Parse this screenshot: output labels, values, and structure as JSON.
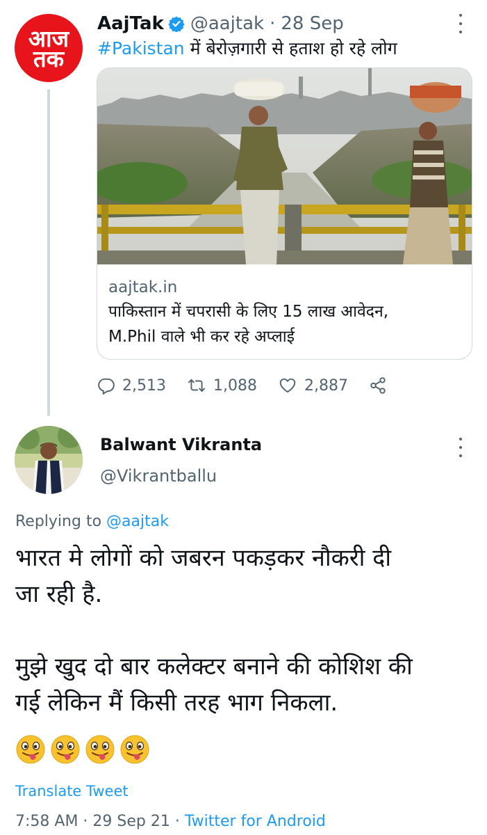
{
  "tweet": {
    "author_name": "AajTak",
    "author_handle": "@aajtak",
    "separator": "·",
    "date": "28 Sep",
    "hashtag": "#Pakistan",
    "text_rest": " में बेरोज़गारी से हताश हो रहे लोग",
    "avatar_logo_line1": "आज",
    "avatar_logo_line2": "तक",
    "card": {
      "domain": "aajtak.in",
      "title_line1": "पाकिस्तान में चपरासी के लिए 15 लाख आवेदन,",
      "title_line2": "M.Phil वाले भी कर रहे अप्लाई"
    },
    "stats": {
      "replies": "2,513",
      "retweets": "1,088",
      "likes": "2,887"
    }
  },
  "reply": {
    "author_name": "Balwant Vikranta",
    "author_handle": "@Vikrantballu",
    "replying_prefix": "Replying to ",
    "replying_to": "@aajtak",
    "line1": "भारत मे लोगों को जबरन पकड़कर नौकरी दी",
    "line2": "जा रही है.",
    "line3": "मुझे खुद दो बार कलेक्टर बनाने की कोशिश की",
    "line4": "गई लेकिन मैं किसी तरह भाग निकला.",
    "emoji_count": 4,
    "translate_label": "Translate Tweet",
    "time": "7:58 AM",
    "sep1": " · ",
    "date": "29 Sep 21",
    "sep2": " · ",
    "source": "Twitter for Android"
  },
  "colors": {
    "brand_red": "#e8141c",
    "link_blue": "#1d9bf0",
    "secondary_gray": "#536471",
    "border_gray": "#cfd9de"
  },
  "icons": [
    "verified-badge-icon",
    "more-options-icon",
    "reply-icon",
    "retweet-icon",
    "like-icon",
    "share-icon",
    "tongue-wink-emoji"
  ]
}
